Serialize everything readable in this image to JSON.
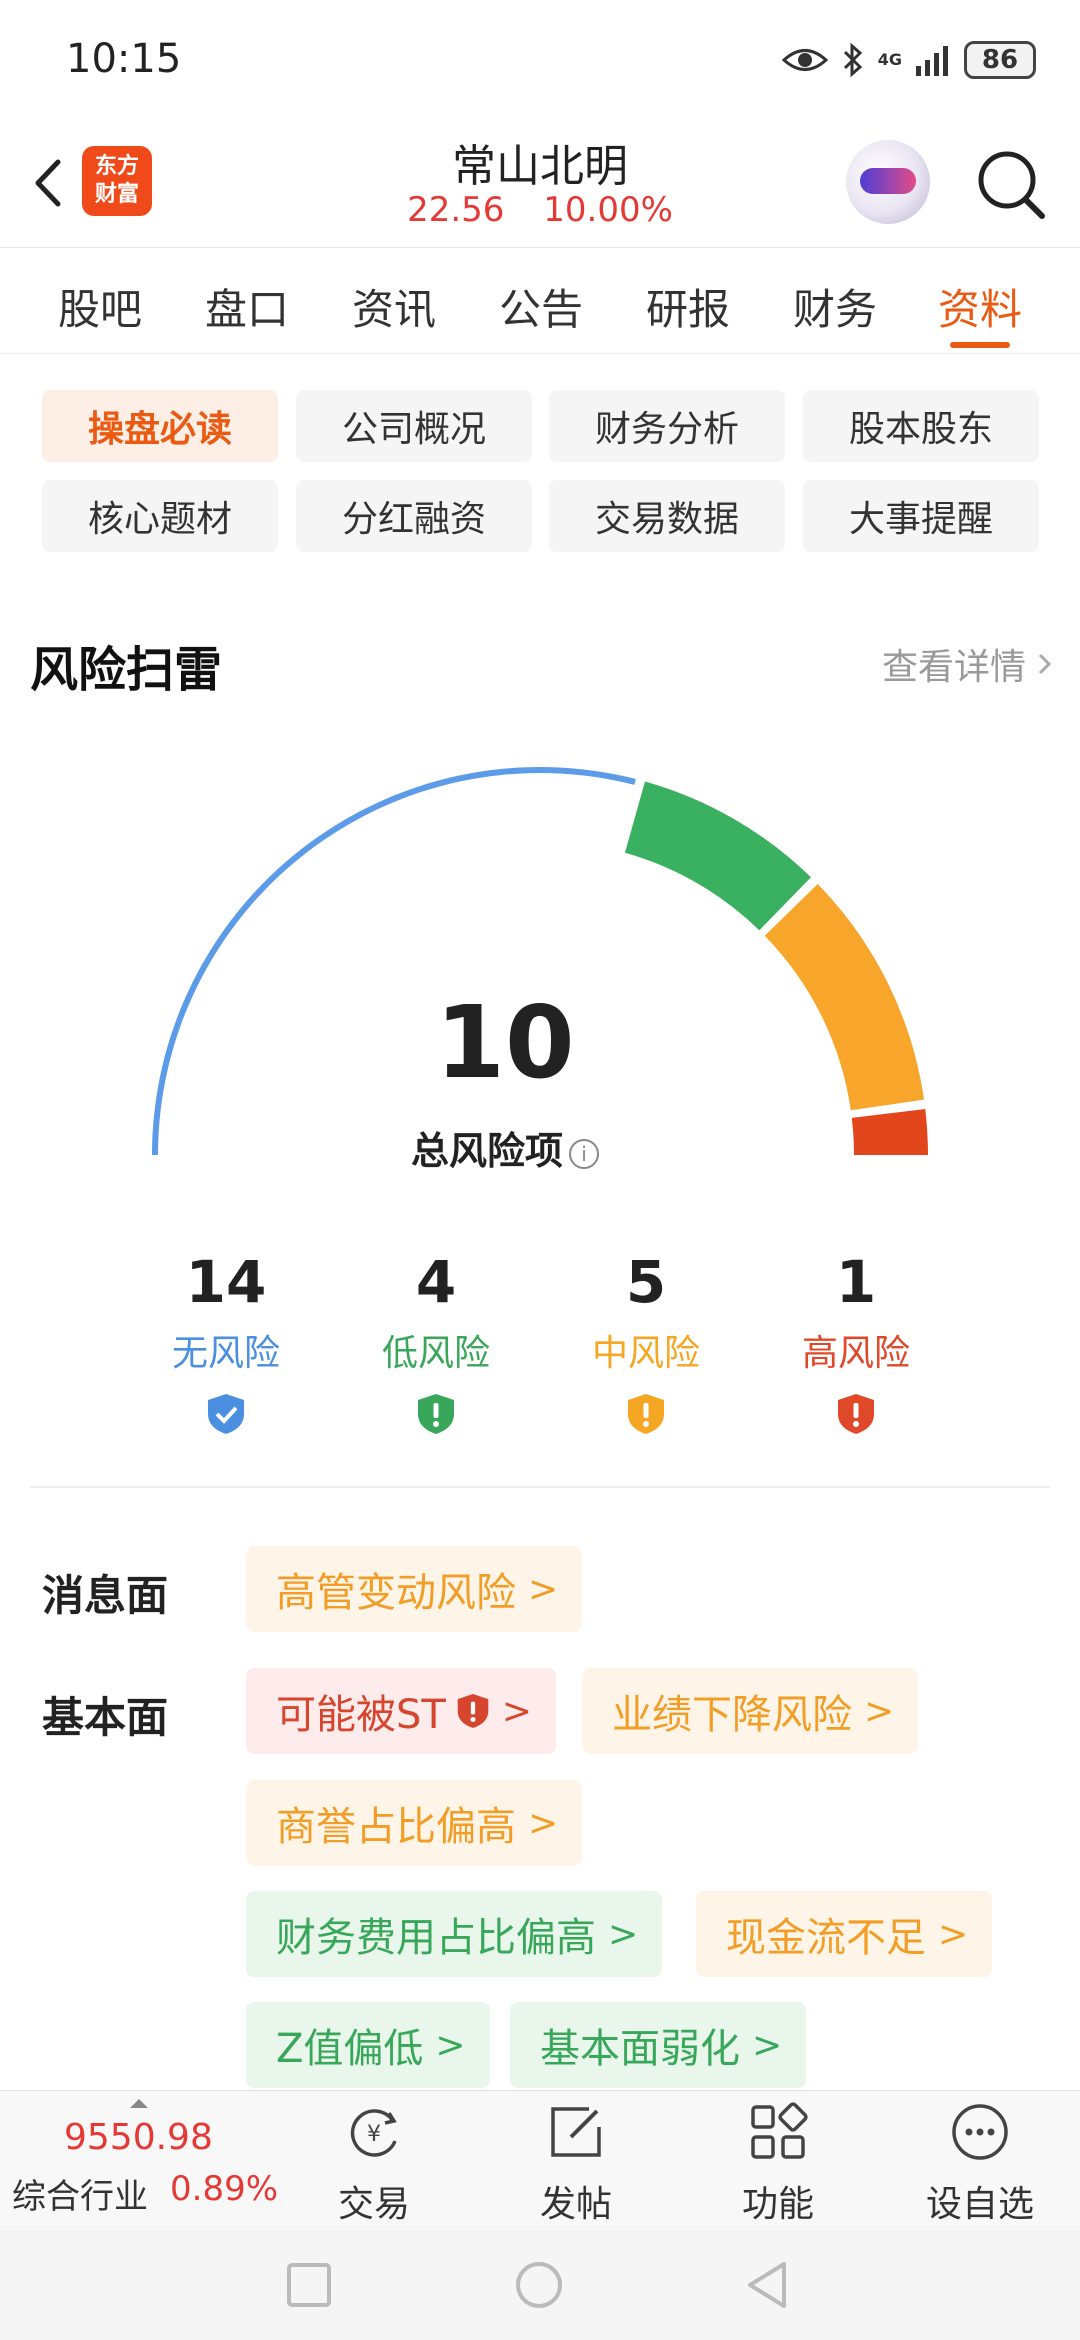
{
  "status": {
    "time": "10:15",
    "battery": "86",
    "network": "4G"
  },
  "header": {
    "logo_line1": "东方",
    "logo_line2": "财富",
    "stock_name": "常山北明",
    "price": "22.56",
    "change_pct": "10.00%"
  },
  "tabs": [
    {
      "label": "股吧"
    },
    {
      "label": "盘口"
    },
    {
      "label": "资讯"
    },
    {
      "label": "公告"
    },
    {
      "label": "研报"
    },
    {
      "label": "财务"
    },
    {
      "label": "资料",
      "active": true
    }
  ],
  "chips": [
    {
      "label": "操盘必读",
      "active": true
    },
    {
      "label": "公司概况"
    },
    {
      "label": "财务分析"
    },
    {
      "label": "股本股东"
    },
    {
      "label": "核心题材"
    },
    {
      "label": "分红融资"
    },
    {
      "label": "交易数据"
    },
    {
      "label": "大事提醒"
    }
  ],
  "risk": {
    "title": "风险扫雷",
    "more": "查看详情",
    "total": "10",
    "total_label": "总风险项",
    "stats": [
      {
        "num": "14",
        "label": "无风险",
        "color": "#4a8fe0"
      },
      {
        "num": "4",
        "label": "低风险",
        "color": "#39a75a"
      },
      {
        "num": "5",
        "label": "中风险",
        "color": "#f5a623"
      },
      {
        "num": "1",
        "label": "高风险",
        "color": "#e0482a"
      }
    ],
    "gauge_counts": {
      "none": 14,
      "low": 4,
      "mid": 5,
      "high": 1
    },
    "colors": {
      "none": "#5b9be8",
      "low": "#3ab160",
      "mid": "#f7a52b",
      "high": "#e2461c"
    }
  },
  "news": {
    "label": "消息面",
    "tags": [
      {
        "text": "高管变动风险"
      }
    ]
  },
  "fundamentals": {
    "label": "基本面",
    "tags": [
      {
        "text": "可能被ST"
      },
      {
        "text": "业绩下降风险"
      },
      {
        "text": "商誉占比偏高"
      },
      {
        "text": "财务费用占比偏高"
      },
      {
        "text": "现金流不足"
      },
      {
        "text": "Z值偏低"
      },
      {
        "text": "基本面弱化"
      }
    ]
  },
  "bottom": {
    "index_value": "9550.98",
    "index_name": "综合行业",
    "index_change": "0.89%",
    "buttons": [
      {
        "label": "交易"
      },
      {
        "label": "发帖"
      },
      {
        "label": "功能"
      },
      {
        "label": "设自选"
      }
    ]
  }
}
